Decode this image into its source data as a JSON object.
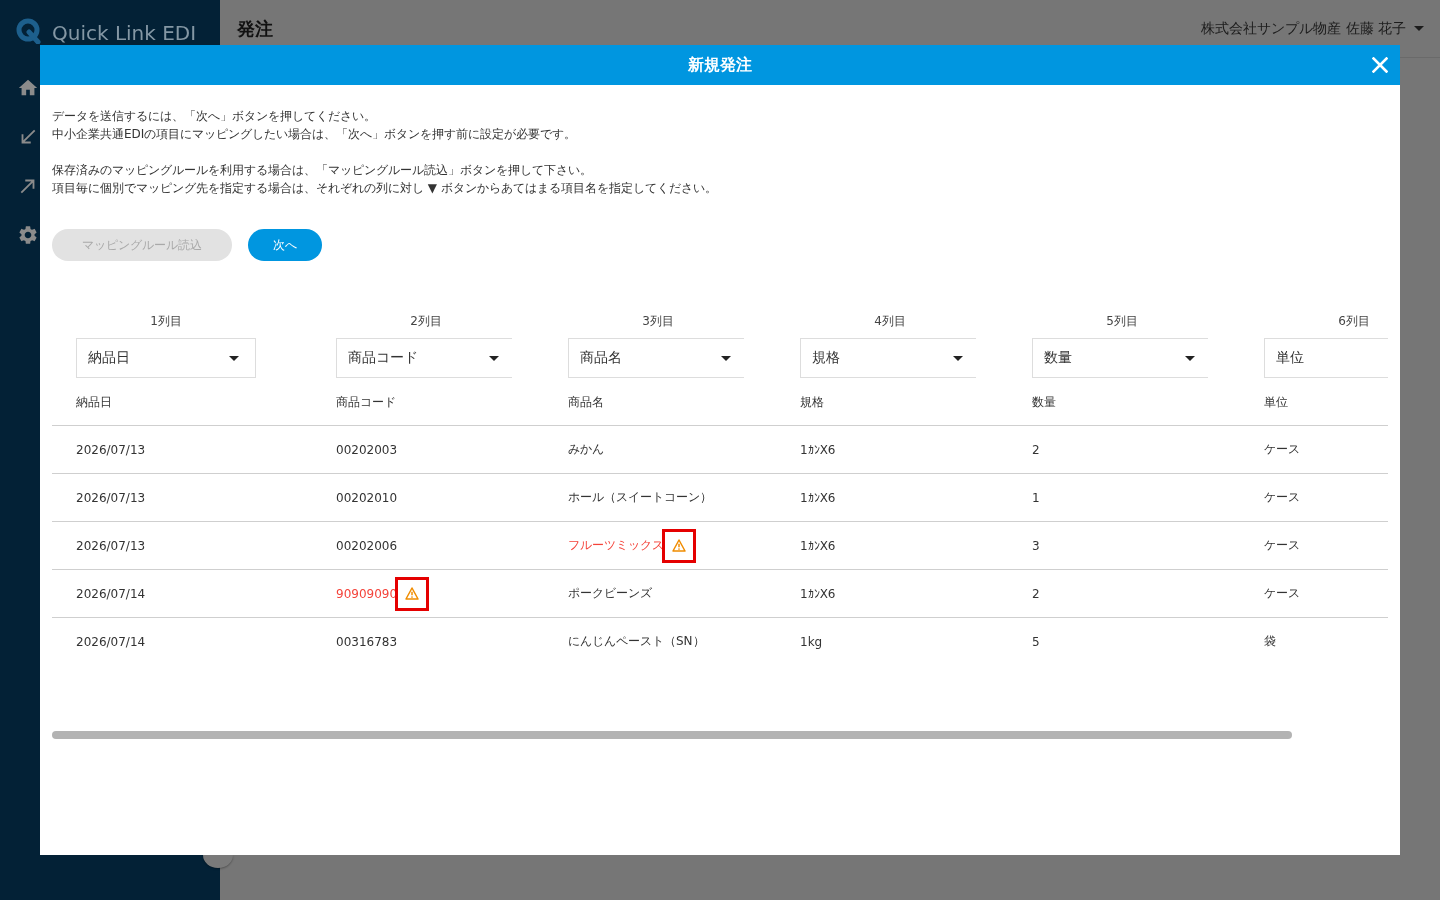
{
  "sidebar": {
    "logo": "Quick Link EDI"
  },
  "header": {
    "title": "発注",
    "user": "株式会社サンプル物産 佐藤 花子"
  },
  "dialog": {
    "title": "新規発注",
    "paragraphs": [
      {
        "lines": [
          "データを送信するには、「次へ」ボタンを押してください。",
          "中小企業共通EDIの項目にマッピングしたい場合は、「次へ」ボタンを押す前に設定が必要です。"
        ]
      },
      {
        "lines": [
          "保存済みのマッピングルールを利用する場合は、「マッピングルール読込」ボタンを押して下さい。",
          "項目毎に個別でマッピング先を指定する場合は、それぞれの列に対し ▼ ボタンからあてはまる項目名を指定してください。"
        ]
      }
    ],
    "buttons": [
      {
        "label": "マッピングルール読込",
        "kind": "secondary",
        "disabled": true
      },
      {
        "label": "次へ",
        "kind": "primary",
        "disabled": false
      }
    ],
    "table": {
      "columns": [
        {
          "heading": "1列目",
          "mapping": "納品日",
          "field": "納品日"
        },
        {
          "heading": "2列目",
          "mapping": "商品コード",
          "field": "商品コード"
        },
        {
          "heading": "3列目",
          "mapping": "商品名",
          "field": "商品名"
        },
        {
          "heading": "4列目",
          "mapping": "規格",
          "field": "規格"
        },
        {
          "heading": "5列目",
          "mapping": "数量",
          "field": "数量"
        },
        {
          "heading": "6列目",
          "mapping": "単位",
          "field": "単位"
        }
      ],
      "rows": [
        {
          "cells": [
            {
              "text": "2026/07/13",
              "error": false
            },
            {
              "text": "00202003",
              "error": false
            },
            {
              "text": "みかん",
              "error": false
            },
            {
              "text": "1ｶﾝX6",
              "error": false
            },
            {
              "text": "2",
              "error": false
            },
            {
              "text": "ケース",
              "error": false
            }
          ]
        },
        {
          "cells": [
            {
              "text": "2026/07/13",
              "error": false
            },
            {
              "text": "00202010",
              "error": false
            },
            {
              "text": "ホール（スイートコーン）",
              "error": false
            },
            {
              "text": "1ｶﾝX6",
              "error": false
            },
            {
              "text": "1",
              "error": false
            },
            {
              "text": "ケース",
              "error": false
            }
          ]
        },
        {
          "cells": [
            {
              "text": "2026/07/13",
              "error": false
            },
            {
              "text": "00202006",
              "error": false
            },
            {
              "text": "フルーツミックス",
              "error": true
            },
            {
              "text": "1ｶﾝX6",
              "error": false
            },
            {
              "text": "3",
              "error": false
            },
            {
              "text": "ケース",
              "error": false
            }
          ]
        },
        {
          "cells": [
            {
              "text": "2026/07/14",
              "error": false
            },
            {
              "text": "90909090",
              "error": true
            },
            {
              "text": "ポークビーンズ",
              "error": false
            },
            {
              "text": "1ｶﾝX6",
              "error": false
            },
            {
              "text": "2",
              "error": false
            },
            {
              "text": "ケース",
              "error": false
            }
          ]
        },
        {
          "cells": [
            {
              "text": "2026/07/14",
              "error": false
            },
            {
              "text": "00316783",
              "error": false
            },
            {
              "text": "にんじんペースト（SN）",
              "error": false
            },
            {
              "text": "1kg",
              "error": false
            },
            {
              "text": "5",
              "error": false
            },
            {
              "text": "袋",
              "error": false
            }
          ]
        }
      ]
    }
  }
}
